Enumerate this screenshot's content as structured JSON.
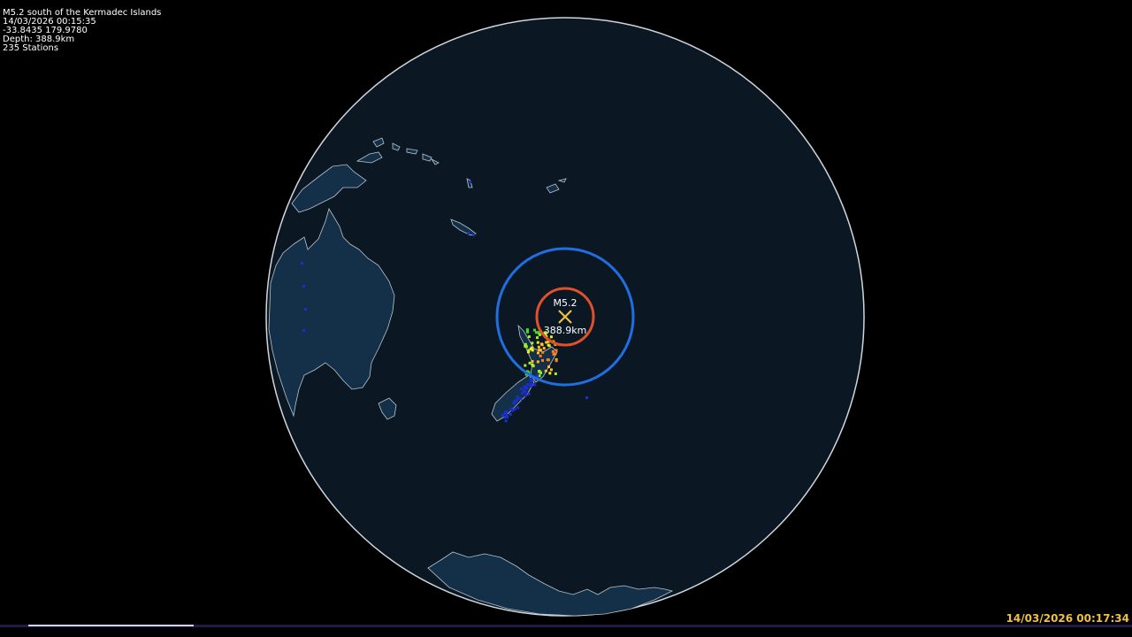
{
  "event": {
    "title": "M5.2 south of the Kermadec Islands",
    "datetime": "14/03/2026 00:15:35",
    "coordinates": "-33.8435 179.9780",
    "depth": "Depth: 388.9km",
    "stations": "235 Stations",
    "magnitude_label": "M5.2",
    "depth_label": "388.9km"
  },
  "clock": "14/03/2026 00:17:34",
  "timeline": {
    "progress": 0.15
  },
  "colors": {
    "background": "#000000",
    "ocean": "#0b1824",
    "land": "#143048",
    "coastline": "#b8c4cc",
    "p_wave_ring": "#1f6fe0",
    "s_wave_ring": "#e0502a",
    "epicenter_marker": "#f0c040",
    "clock_text": "#f0c040"
  },
  "icons": {
    "epicenter": "epicenter-x-icon"
  }
}
